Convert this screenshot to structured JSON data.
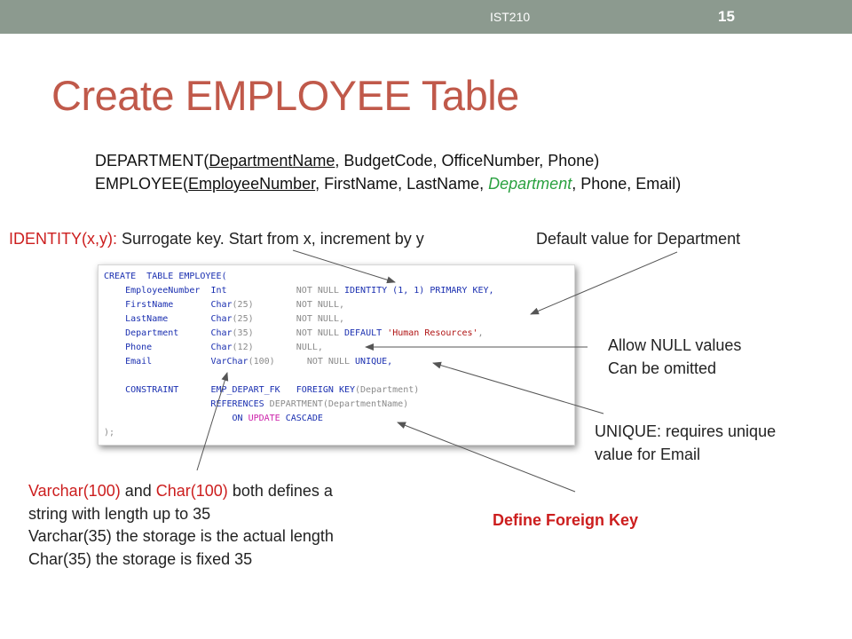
{
  "header": {
    "course": "IST210",
    "slide_number": "15"
  },
  "title": "Create EMPLOYEE Table",
  "schema": {
    "department": {
      "prefix": "DEPARTMENT(",
      "key": "DepartmentName",
      "rest": ", BudgetCode, OfficeNumber, Phone)"
    },
    "employee": {
      "prefix": "EMPLOYEE(",
      "key": "EmployeeNumber",
      "mid": ", FirstName, LastName, ",
      "fk": "Department",
      "rest": ", Phone, Email)"
    }
  },
  "annotations": {
    "identity": {
      "label": "IDENTITY(x,y):",
      "text": "Surrogate key. Start from x, increment by y"
    },
    "default": "Default value for Department",
    "null_line1": "Allow NULL values",
    "null_line2": "Can be omitted",
    "unique_line1": "UNIQUE: requires unique",
    "unique_line2": "value for Email",
    "foreign_key": "Define Foreign Key",
    "varchar": {
      "l1_a": "Varchar(100)",
      "l1_b": " and ",
      "l1_c": "Char(100)",
      "l1_d": " both defines a",
      "l2": "string with length up to 35",
      "l3": "Varchar(35) the storage is the actual length",
      "l4": "Char(35) the storage is fixed 35"
    }
  },
  "code": {
    "l1a": "CREATE",
    "l1b": "TABLE",
    "l1c": "EMPLOYEE(",
    "rows": [
      {
        "col": "EmployeeNumber",
        "type": "Int",
        "size": "",
        "rest": "NOT NULL",
        "extra": "IDENTITY (1, 1) PRIMARY KEY,"
      },
      {
        "col": "FirstName",
        "type": "Char",
        "size": "(25)",
        "rest": "NOT NULL,",
        "extra": ""
      },
      {
        "col": "LastName",
        "type": "Char",
        "size": "(25)",
        "rest": "NOT NULL,",
        "extra": ""
      },
      {
        "col": "Department",
        "type": "Char",
        "size": "(35)",
        "rest": "NOT NULL",
        "extra": "DEFAULT",
        "str": "'Human Resources'",
        "tail": ","
      },
      {
        "col": "Phone",
        "type": "Char",
        "size": "(12)",
        "rest": "NULL,",
        "extra": ""
      },
      {
        "col": "Email",
        "type": "VarChar",
        "size": "(100)",
        "rest": "NOT NULL",
        "extra": "UNIQUE,"
      }
    ],
    "constraint": "CONSTRAINT",
    "constraint_name": "EMP_DEPART_FK",
    "fk_clause": "FOREIGN KEY",
    "fk_col": "(Department)",
    "references": "REFERENCES",
    "ref_target": "DEPARTMENT(DepartmentName)",
    "on": "ON",
    "update": "UPDATE",
    "cascade": "CASCADE",
    "end": ");"
  },
  "colors": {
    "title": "#c0594a",
    "topbar": "#8c9a8f",
    "fk_green": "#2aa140",
    "annotation_red": "#cc1e1e"
  }
}
